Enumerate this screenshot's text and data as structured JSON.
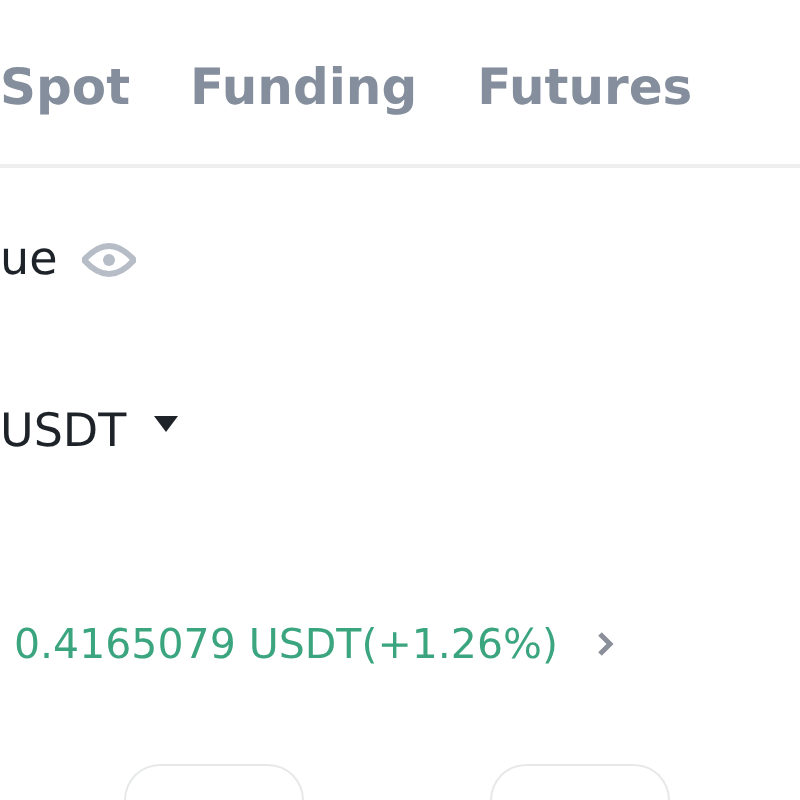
{
  "tabs": [
    {
      "label": "Spot"
    },
    {
      "label": "Funding"
    },
    {
      "label": "Futures"
    }
  ],
  "balance_label": "ue",
  "currency": "USDT",
  "pnl": "0.4165079 USDT(+1.26%)"
}
